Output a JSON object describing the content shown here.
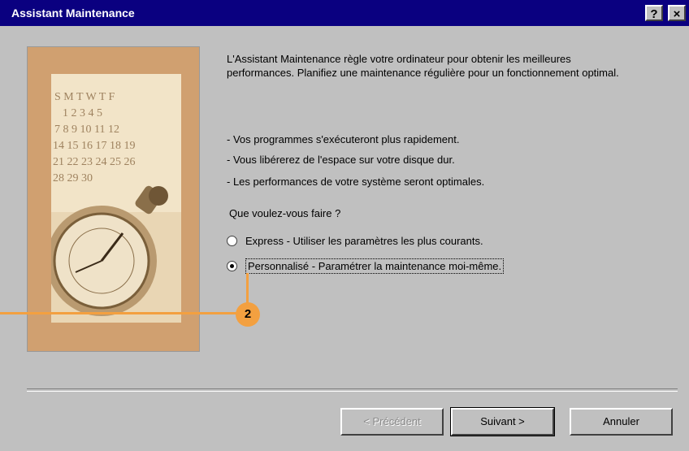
{
  "window": {
    "title": "Assistant Maintenance",
    "help_label": "?",
    "close_label": "×"
  },
  "intro_text": "L'Assistant Maintenance règle votre ordinateur pour obtenir les meilleures performances. Planifiez une maintenance régulière pour un fonctionnement optimal.",
  "benefits": [
    "- Vos programmes s'exécuteront plus rapidement.",
    "- Vous libérerez de l'espace sur votre disque dur.",
    "- Les performances de votre système seront optimales."
  ],
  "question": "Que voulez-vous faire ?",
  "options": [
    {
      "label": "Express - Utiliser les paramètres les plus courants.",
      "selected": false
    },
    {
      "label": "Personnalisé - Paramétrer la maintenance moi-même.",
      "selected": true
    }
  ],
  "callout": {
    "number": "2",
    "color": "#f3a040"
  },
  "buttons": {
    "previous": "< Précédent",
    "next": "Suivant >",
    "cancel": "Annuler"
  },
  "illustration": {
    "calendar_days": [
      "S M T W T F",
      "1 2 3 4 5",
      "7 8 9 10 11 12",
      "14 15 16 17 18 19",
      "21 22 23 24 25 26",
      "28 29 30"
    ]
  },
  "colors": {
    "titlebar": "#0a0080",
    "dialog_bg": "#c0c0c0",
    "illustration_frame": "#d0a070"
  }
}
